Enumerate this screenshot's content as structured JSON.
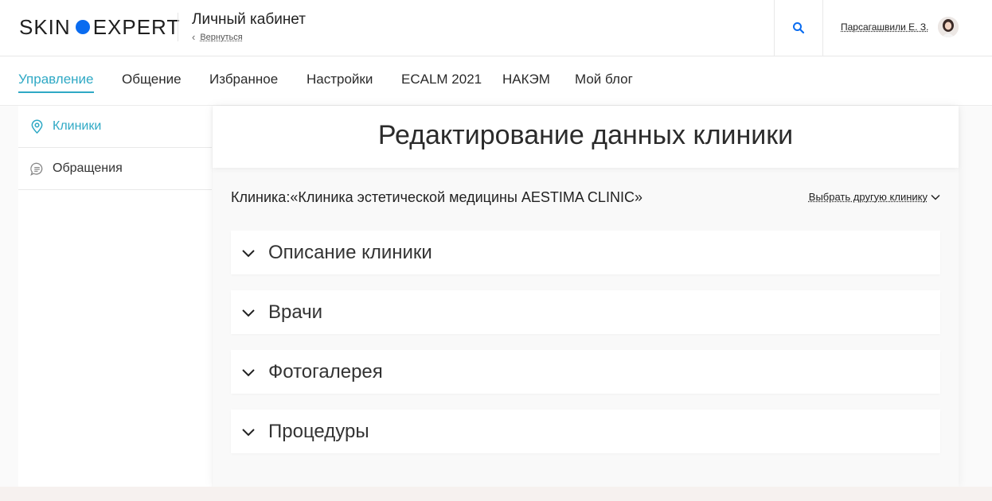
{
  "header": {
    "logo_left": "SKIN",
    "logo_right": "EXPERT",
    "cabinet_title": "Личный кабинет",
    "back_label": "Вернуться",
    "user_name": "Парсагашвили Е. З.",
    "search_icon": "search-icon",
    "accent_color": "#0a6cf0"
  },
  "nav": {
    "items": [
      {
        "label": "Управление",
        "active": true
      },
      {
        "label": "Общение"
      },
      {
        "label": "Избранное"
      },
      {
        "label": "Настройки"
      },
      {
        "label": "ECALM 2021"
      },
      {
        "label": "НАКЭМ"
      },
      {
        "label": "Мой блог"
      }
    ],
    "active_color": "#2fa9c5"
  },
  "sidebar": {
    "items": [
      {
        "label": "Клиники",
        "icon": "location-pin-icon",
        "active": true
      },
      {
        "label": "Обращения",
        "icon": "chat-icon"
      }
    ]
  },
  "main": {
    "title": "Редактирование данных клиники",
    "clinic_label": "Клиника:«Клиника эстетической медицины AESTIMA CLINIC»",
    "choose_other": "Выбрать другую клинику",
    "sections": [
      {
        "label": "Описание клиники"
      },
      {
        "label": "Врачи"
      },
      {
        "label": "Фотогалерея"
      },
      {
        "label": "Процедуры"
      }
    ]
  }
}
